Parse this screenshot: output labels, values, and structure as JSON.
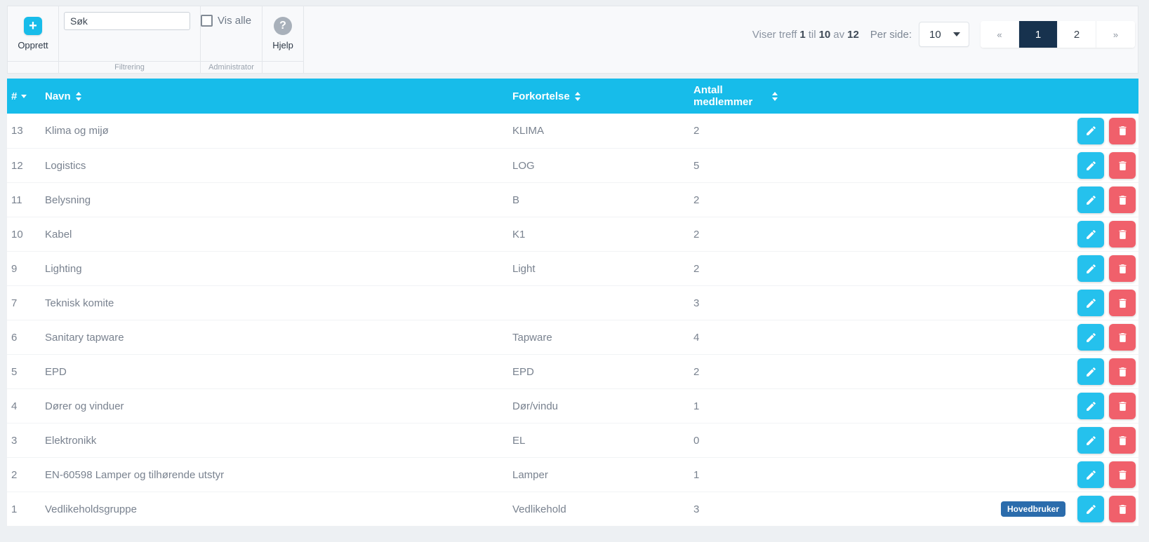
{
  "toolbar": {
    "create": {
      "label": "Opprett"
    },
    "filter": {
      "search_value": "Søk",
      "section_label": "Filtrering"
    },
    "admin": {
      "show_all_label": "Vis alle",
      "show_all_checked": false,
      "section_label": "Administrator"
    },
    "help": {
      "label": "Hjelp"
    }
  },
  "results_summary": {
    "prefix": "Viser treff",
    "start": "1",
    "connector": "til",
    "end": "10",
    "of_word": "av",
    "total": "12"
  },
  "per_page": {
    "label": "Per side:",
    "selected": "10"
  },
  "pagination": {
    "prev_label": "«",
    "next_label": "»",
    "pages": [
      "1",
      "2"
    ],
    "active_page": "1"
  },
  "table": {
    "columns": [
      {
        "label": "#",
        "sort": "desc"
      },
      {
        "label": "Navn",
        "sort": "both"
      },
      {
        "label": "Forkortelse",
        "sort": "both"
      },
      {
        "label": "Antall medlemmer",
        "sort": "both"
      }
    ],
    "rows": [
      {
        "id": "13",
        "name": "Klima og mijø",
        "abbr": "KLIMA",
        "members": "2",
        "badge": ""
      },
      {
        "id": "12",
        "name": "Logistics",
        "abbr": "LOG",
        "members": "5",
        "badge": ""
      },
      {
        "id": "11",
        "name": "Belysning",
        "abbr": "B",
        "members": "2",
        "badge": ""
      },
      {
        "id": "10",
        "name": "Kabel",
        "abbr": "K1",
        "members": "2",
        "badge": ""
      },
      {
        "id": "9",
        "name": "Lighting",
        "abbr": "Light",
        "members": "2",
        "badge": ""
      },
      {
        "id": "7",
        "name": "Teknisk komite",
        "abbr": "",
        "members": "3",
        "badge": ""
      },
      {
        "id": "6",
        "name": "Sanitary tapware",
        "abbr": "Tapware",
        "members": "4",
        "badge": ""
      },
      {
        "id": "5",
        "name": "EPD",
        "abbr": "EPD",
        "members": "2",
        "badge": ""
      },
      {
        "id": "4",
        "name": "Dører og vinduer",
        "abbr": "Dør/vindu",
        "members": "1",
        "badge": ""
      },
      {
        "id": "3",
        "name": "Elektronikk",
        "abbr": "EL",
        "members": "0",
        "badge": ""
      },
      {
        "id": "2",
        "name": "EN-60598 Lamper og tilhørende utstyr",
        "abbr": "Lamper",
        "members": "1",
        "badge": ""
      },
      {
        "id": "1",
        "name": "Vedlikeholdsgruppe",
        "abbr": "Vedlikehold",
        "members": "3",
        "badge": "Hovedbruker"
      }
    ]
  },
  "colors": {
    "accent_cyan": "#17bcea",
    "edit_button_cyan": "#25c1ed",
    "delete_button_red": "#f0606b",
    "badge_blue": "#2b6cac",
    "active_page_navy": "#17324e",
    "header_text": "#ffffff",
    "row_text": "#79828f"
  }
}
